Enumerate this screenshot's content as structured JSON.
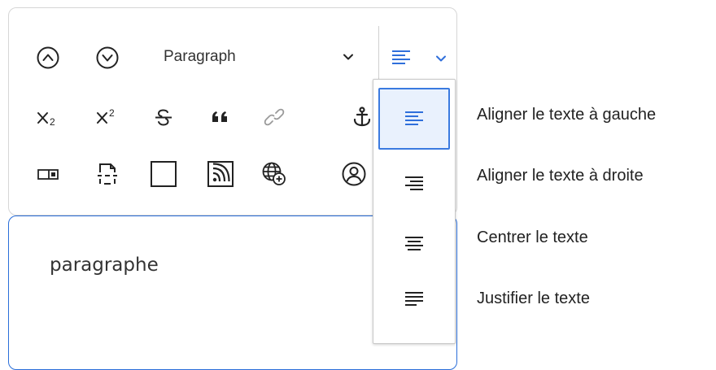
{
  "toolbar": {
    "row1": {
      "buttons": [
        {
          "name": "heading-up",
          "icon": "chevron-up-circle-icon"
        },
        {
          "name": "heading-down",
          "icon": "chevron-down-circle-icon"
        }
      ],
      "heading_select": {
        "value": "Paragraph",
        "icon": "chevron-down-icon"
      },
      "alignment_trigger": {
        "icon": "align-left-icon",
        "chevron_icon": "chevron-down-icon"
      }
    },
    "row2": {
      "buttons": [
        {
          "name": "subscript",
          "icon": "subscript-icon"
        },
        {
          "name": "superscript",
          "icon": "superscript-icon"
        },
        {
          "name": "strikethrough",
          "icon": "strikethrough-icon"
        },
        {
          "name": "blockquote",
          "icon": "quote-icon"
        },
        {
          "name": "link",
          "icon": "link-icon",
          "disabled": true
        },
        {
          "name": "anchor",
          "icon": "anchor-icon"
        }
      ]
    },
    "row3": {
      "buttons": [
        {
          "name": "toggle-block",
          "icon": "toggle-icon"
        },
        {
          "name": "page-break",
          "icon": "page-break-icon"
        },
        {
          "name": "box",
          "icon": "square-icon"
        },
        {
          "name": "rss",
          "icon": "rss-icon"
        },
        {
          "name": "insert-web",
          "icon": "globe-add-icon"
        },
        {
          "name": "profile",
          "icon": "user-circle-icon"
        }
      ]
    }
  },
  "editor": {
    "content": "paragraphe"
  },
  "alignment_dropdown": {
    "options": [
      {
        "icon": "align-left-icon",
        "label": "Aligner le texte à gauche",
        "active": true
      },
      {
        "icon": "align-right-icon",
        "label": "Aligner le texte à droite",
        "active": false
      },
      {
        "icon": "align-center-icon",
        "label": "Centrer le texte",
        "active": false
      },
      {
        "icon": "align-justify-icon",
        "label": "Justifier le texte",
        "active": false
      }
    ]
  },
  "colors": {
    "accent": "#3a7ae0",
    "active_bg": "#e9f1fd",
    "icon": "#222222",
    "disabled_icon": "#9a9a9a"
  }
}
